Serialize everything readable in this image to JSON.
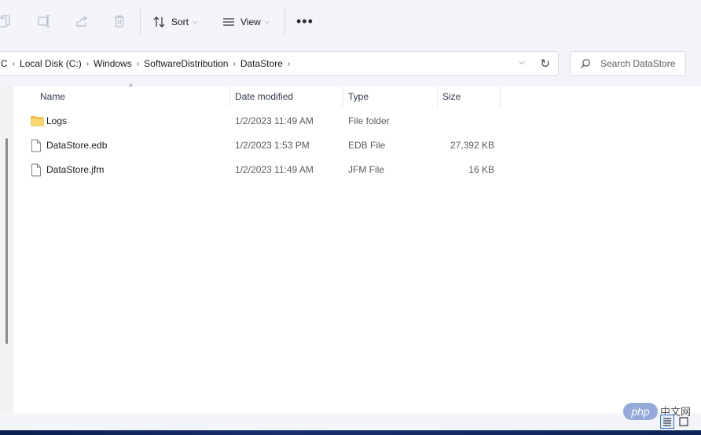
{
  "toolbar": {
    "sort_label": "Sort",
    "view_label": "View",
    "more_label": "•••",
    "icons": [
      "copy-icon",
      "rename-icon",
      "share-icon",
      "delete-icon",
      "sort-icon",
      "view-icon"
    ]
  },
  "address": {
    "crumbs": [
      "C",
      "Local Disk (C:)",
      "Windows",
      "SoftwareDistribution",
      "DataStore"
    ],
    "separator": "›",
    "dropdown": "⌵",
    "refresh": "↻"
  },
  "search": {
    "placeholder": "Search DataStore"
  },
  "columns": {
    "name": "Name",
    "date": "Date modified",
    "type": "Type",
    "size": "Size",
    "sort_caret": "^"
  },
  "files": [
    {
      "icon": "folder-icon",
      "name": "Logs",
      "date": "1/2/2023 11:49 AM",
      "type": "File folder",
      "size": ""
    },
    {
      "icon": "file-icon",
      "name": "DataStore.edb",
      "date": "1/2/2023 1:53 PM",
      "type": "EDB File",
      "size": "27,392 KB"
    },
    {
      "icon": "file-icon",
      "name": "DataStore.jfm",
      "date": "1/2/2023 11:49 AM",
      "type": "JFM File",
      "size": "16 KB"
    }
  ],
  "watermark": {
    "logo": "php",
    "text": "中文网"
  },
  "colors": {
    "accent": "#3a6fc4",
    "folder": "#f4c24d",
    "toolbar_bg": "#f3f5fb"
  }
}
